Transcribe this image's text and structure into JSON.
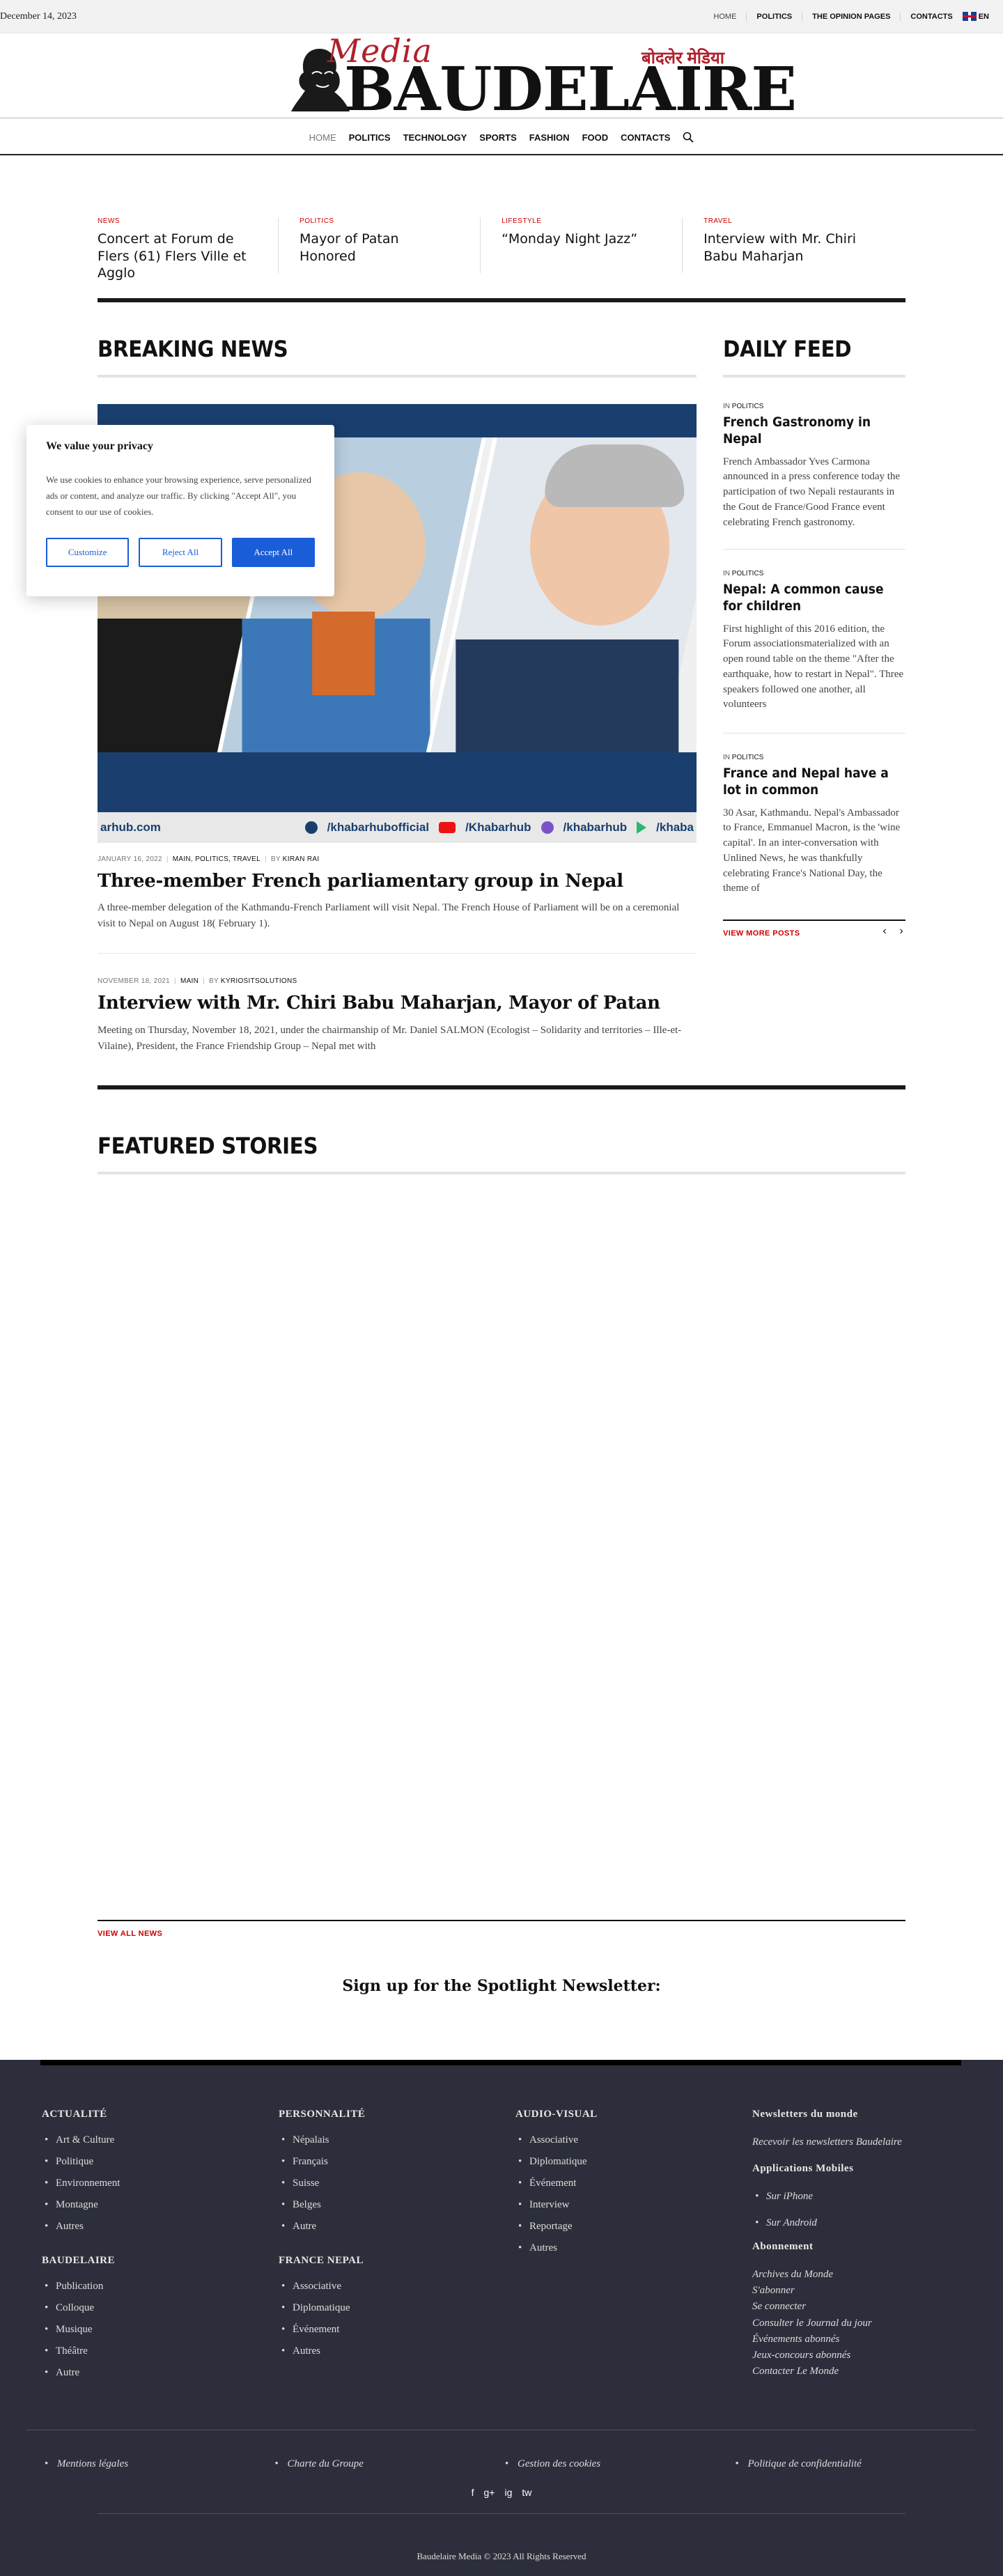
{
  "topbar": {
    "date": "December 14, 2023",
    "links": [
      "HOME",
      "POLITICS",
      "THE OPINION PAGES",
      "CONTACTS"
    ],
    "lang": "EN"
  },
  "logo": {
    "script": "Media",
    "wordmark": "BAUDELAIRE",
    "nepali": "बोदलेर मेडिया"
  },
  "nav": {
    "items": [
      "HOME",
      "POLITICS",
      "TECHNOLOGY",
      "SPORTS",
      "FASHION",
      "FOOD",
      "CONTACTS"
    ]
  },
  "ticker": [
    {
      "category": "NEWS",
      "title": "Concert at Forum de Flers (61) Flers Ville et Agglo"
    },
    {
      "category": "POLITICS",
      "title": "Mayor of Patan Honored"
    },
    {
      "category": "LIFESTYLE",
      "title": "“Monday Night Jazz”"
    },
    {
      "category": "TRAVEL",
      "title": "Interview with Mr. Chiri Babu Maharjan"
    }
  ],
  "breaking": {
    "title": "BREAKING NEWS",
    "image_bottom_left": "arhub.com",
    "image_social": [
      "/khabarhubofficial",
      "/Khabarhub",
      "/khabarhub",
      "/khaba"
    ],
    "articles": [
      {
        "date": "JANUARY 16, 2022",
        "categories": "MAIN, POLITICS, TRAVEL",
        "by": "BY",
        "author": "KIRAN RAI",
        "title": "Three-member French parliamentary group in Nepal",
        "excerpt": "A three-member delegation of the Kathmandu-French Parliament will visit Nepal. The French House of Parliament will be on a ceremonial visit to Nepal on August 18( February 1)."
      },
      {
        "date": "NOVEMBER 18, 2021",
        "categories": "MAIN",
        "by": "BY",
        "author": "KYRIOSITSOLUTIONS",
        "title": "Interview with Mr. Chiri Babu Maharjan, Mayor of Patan",
        "excerpt": "Meeting on Thursday, November 18, 2021, under the chairmanship of Mr. Daniel SALMON (Ecologist – Solidarity and territories – Ille-et-Vilaine), President, the France Friendship Group – Nepal met with"
      }
    ]
  },
  "feed": {
    "title": "DAILY FEED",
    "in": "IN",
    "items": [
      {
        "category": "POLITICS",
        "title": "French Gastronomy in Nepal",
        "excerpt": "French Ambassador Yves Carmona announced in a press conference today the participation of two Nepali restaurants in the Gout de France/Good France event celebrating French gastronomy."
      },
      {
        "category": "POLITICS",
        "title": "Nepal: A common cause for children",
        "excerpt": "First highlight of this 2016 edition, the Forum associationsmaterialized with an open round table on the theme \"After the earthquake, how to restart in Nepal\". Three speakers followed one another, all volunteers"
      },
      {
        "category": "POLITICS",
        "title": "France and Nepal have a lot in common",
        "excerpt": "30 Asar, Kathmandu. Nepal's Ambassador to France, Emmanuel Macron, is the 'wine capital'. In an inter-conversation with Unlined News, he was thankfully celebrating France's National Day, the theme of"
      }
    ],
    "view_more": "VIEW MORE POSTS",
    "prev": "‹",
    "next": "›"
  },
  "cookie": {
    "title": "We value your privacy",
    "text": "We use cookies to enhance your browsing experience, serve personalized ads or content, and analyze our traffic. By clicking \"Accept All\", you consent to our use of cookies.",
    "customize": "Customize",
    "reject": "Reject All",
    "accept": "Accept All"
  },
  "featured": {
    "title": "FEATURED STORIES",
    "view_all": "VIEW ALL NEWS"
  },
  "newsletter": {
    "title": "Sign up for the Spotlight Newsletter:"
  },
  "footer": {
    "actualite": {
      "title": "ACTUALITÉ",
      "items": [
        "Art & Culture",
        "Politique",
        "Environnement",
        "Montagne",
        "Autres"
      ]
    },
    "personnalite": {
      "title": "PERSONNALITÉ",
      "items": [
        "Népalais",
        "Français",
        "Suisse",
        "Belges",
        "Autre"
      ]
    },
    "audiovisuel": {
      "title": "AUDIO-VISUAL",
      "items": [
        "Associative",
        "Diplomatique",
        "Événement",
        "Interview",
        "Reportage",
        "Autres"
      ]
    },
    "baudelaire": {
      "title": "BAUDELAIRE",
      "items": [
        "Publication",
        "Colloque",
        "Musique",
        "Théâtre",
        "Autre"
      ]
    },
    "france_nepal": {
      "title": "FRANCE NEPAL",
      "items": [
        "Associative",
        "Diplomatique",
        "Événement",
        "Autres"
      ]
    },
    "newsletters": {
      "title": "Newsletters du monde",
      "link": "Recevoir les newsletters Baudelaire"
    },
    "apps": {
      "title": "Applications Mobiles",
      "items": [
        "Sur iPhone",
        "Sur Android"
      ]
    },
    "abonnement": {
      "title": "Abonnement",
      "items": [
        "Archives du Monde",
        "S'abonner",
        "Se connecter",
        "Consulter le Journal du jour",
        "Événements abonnés",
        "Jeux-concours abonnés",
        "Contacter Le Monde"
      ]
    },
    "legal": [
      "Mentions légales",
      "Charte du Groupe",
      "Gestion des cookies",
      "Politique de confidentialité"
    ],
    "social": [
      "f",
      "g+",
      "ig",
      "tw"
    ],
    "copyright": "Baudelaire Media © 2023 All Rights Reserved"
  },
  "colors": {
    "accent": "#cc0000",
    "brand_red": "#b0202b",
    "button_blue": "#1a5dd8",
    "footer_bg": "#2c2f3b"
  }
}
